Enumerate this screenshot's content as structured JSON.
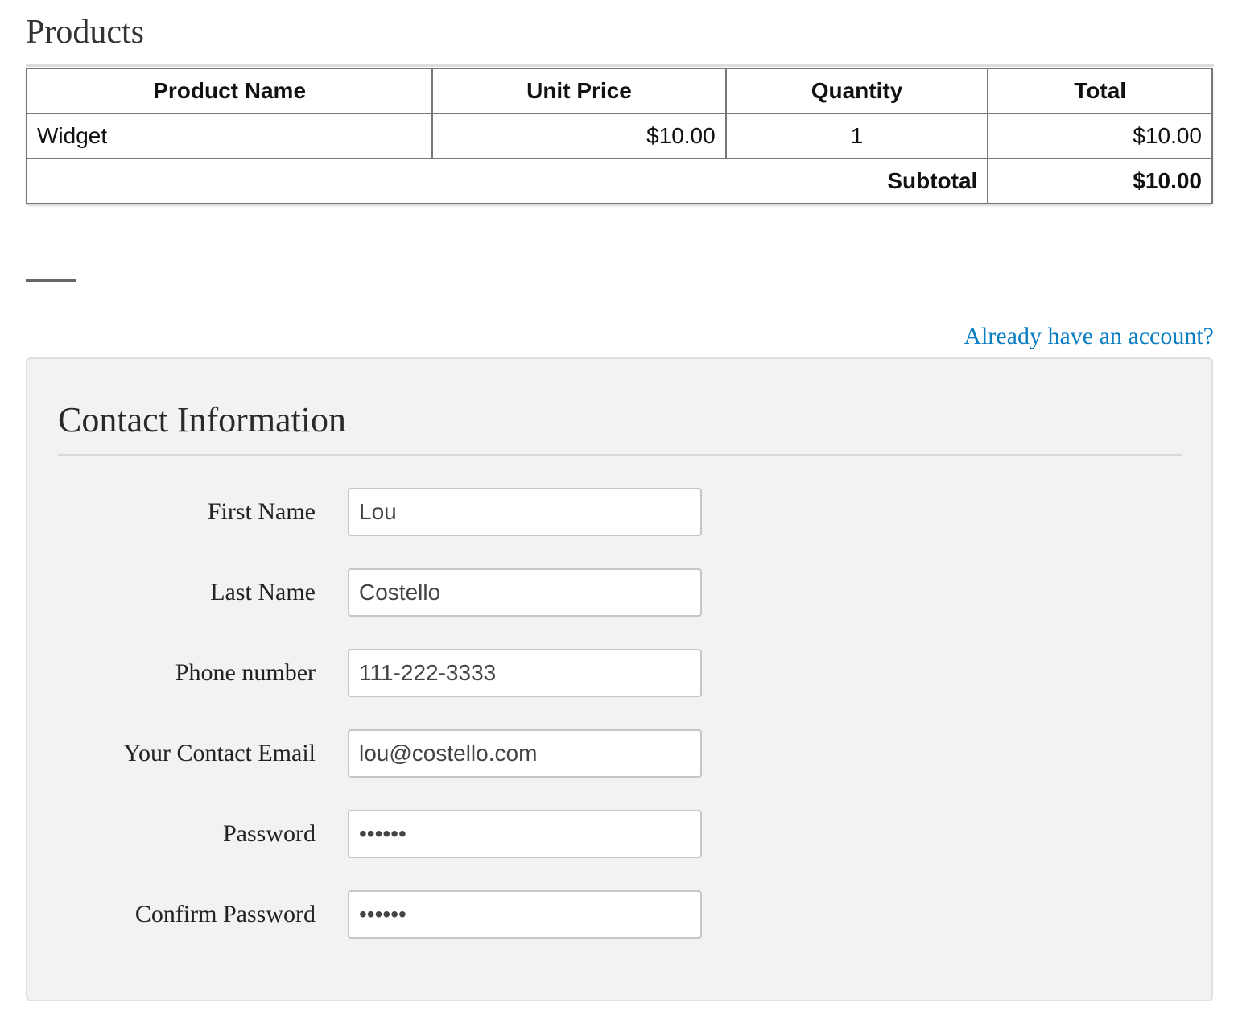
{
  "products_section": {
    "heading": "Products",
    "table": {
      "headers": [
        "Product Name",
        "Unit Price",
        "Quantity",
        "Total"
      ],
      "rows": [
        {
          "name": "Widget",
          "unit_price": "$10.00",
          "quantity": "1",
          "total": "$10.00"
        }
      ],
      "subtotal_label": "Subtotal",
      "subtotal_value": "$10.00"
    }
  },
  "account_link": "Already have an account?",
  "contact": {
    "title": "Contact Information",
    "fields": [
      {
        "label": "First Name",
        "value": "Lou",
        "type": "text"
      },
      {
        "label": "Last Name",
        "value": "Costello",
        "type": "text"
      },
      {
        "label": "Phone number",
        "value": "111-222-3333",
        "type": "tel"
      },
      {
        "label": "Your Contact Email",
        "value": "lou@costello.com",
        "type": "email"
      },
      {
        "label": "Password",
        "value": "••••••",
        "type": "password"
      },
      {
        "label": "Confirm Password",
        "value": "••••••",
        "type": "password"
      }
    ]
  },
  "colors": {
    "link": "#0a7ec2",
    "panel_background": "#f2f2f2",
    "table_border": "#777777"
  }
}
